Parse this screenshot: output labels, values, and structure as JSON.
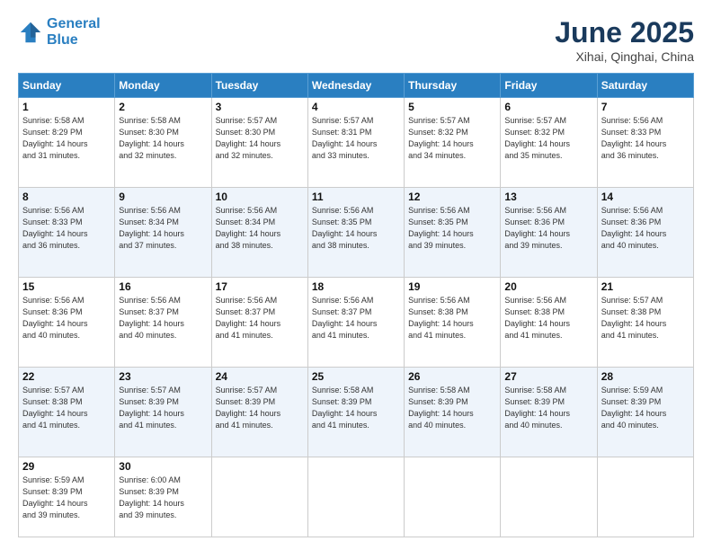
{
  "logo": {
    "line1": "General",
    "line2": "Blue"
  },
  "title": "June 2025",
  "location": "Xihai, Qinghai, China",
  "headers": [
    "Sunday",
    "Monday",
    "Tuesday",
    "Wednesday",
    "Thursday",
    "Friday",
    "Saturday"
  ],
  "rows": [
    [
      {
        "day": "1",
        "info": "Sunrise: 5:58 AM\nSunset: 8:29 PM\nDaylight: 14 hours\nand 31 minutes."
      },
      {
        "day": "2",
        "info": "Sunrise: 5:58 AM\nSunset: 8:30 PM\nDaylight: 14 hours\nand 32 minutes."
      },
      {
        "day": "3",
        "info": "Sunrise: 5:57 AM\nSunset: 8:30 PM\nDaylight: 14 hours\nand 32 minutes."
      },
      {
        "day": "4",
        "info": "Sunrise: 5:57 AM\nSunset: 8:31 PM\nDaylight: 14 hours\nand 33 minutes."
      },
      {
        "day": "5",
        "info": "Sunrise: 5:57 AM\nSunset: 8:32 PM\nDaylight: 14 hours\nand 34 minutes."
      },
      {
        "day": "6",
        "info": "Sunrise: 5:57 AM\nSunset: 8:32 PM\nDaylight: 14 hours\nand 35 minutes."
      },
      {
        "day": "7",
        "info": "Sunrise: 5:56 AM\nSunset: 8:33 PM\nDaylight: 14 hours\nand 36 minutes."
      }
    ],
    [
      {
        "day": "8",
        "info": "Sunrise: 5:56 AM\nSunset: 8:33 PM\nDaylight: 14 hours\nand 36 minutes."
      },
      {
        "day": "9",
        "info": "Sunrise: 5:56 AM\nSunset: 8:34 PM\nDaylight: 14 hours\nand 37 minutes."
      },
      {
        "day": "10",
        "info": "Sunrise: 5:56 AM\nSunset: 8:34 PM\nDaylight: 14 hours\nand 38 minutes."
      },
      {
        "day": "11",
        "info": "Sunrise: 5:56 AM\nSunset: 8:35 PM\nDaylight: 14 hours\nand 38 minutes."
      },
      {
        "day": "12",
        "info": "Sunrise: 5:56 AM\nSunset: 8:35 PM\nDaylight: 14 hours\nand 39 minutes."
      },
      {
        "day": "13",
        "info": "Sunrise: 5:56 AM\nSunset: 8:36 PM\nDaylight: 14 hours\nand 39 minutes."
      },
      {
        "day": "14",
        "info": "Sunrise: 5:56 AM\nSunset: 8:36 PM\nDaylight: 14 hours\nand 40 minutes."
      }
    ],
    [
      {
        "day": "15",
        "info": "Sunrise: 5:56 AM\nSunset: 8:36 PM\nDaylight: 14 hours\nand 40 minutes."
      },
      {
        "day": "16",
        "info": "Sunrise: 5:56 AM\nSunset: 8:37 PM\nDaylight: 14 hours\nand 40 minutes."
      },
      {
        "day": "17",
        "info": "Sunrise: 5:56 AM\nSunset: 8:37 PM\nDaylight: 14 hours\nand 41 minutes."
      },
      {
        "day": "18",
        "info": "Sunrise: 5:56 AM\nSunset: 8:37 PM\nDaylight: 14 hours\nand 41 minutes."
      },
      {
        "day": "19",
        "info": "Sunrise: 5:56 AM\nSunset: 8:38 PM\nDaylight: 14 hours\nand 41 minutes."
      },
      {
        "day": "20",
        "info": "Sunrise: 5:56 AM\nSunset: 8:38 PM\nDaylight: 14 hours\nand 41 minutes."
      },
      {
        "day": "21",
        "info": "Sunrise: 5:57 AM\nSunset: 8:38 PM\nDaylight: 14 hours\nand 41 minutes."
      }
    ],
    [
      {
        "day": "22",
        "info": "Sunrise: 5:57 AM\nSunset: 8:38 PM\nDaylight: 14 hours\nand 41 minutes."
      },
      {
        "day": "23",
        "info": "Sunrise: 5:57 AM\nSunset: 8:39 PM\nDaylight: 14 hours\nand 41 minutes."
      },
      {
        "day": "24",
        "info": "Sunrise: 5:57 AM\nSunset: 8:39 PM\nDaylight: 14 hours\nand 41 minutes."
      },
      {
        "day": "25",
        "info": "Sunrise: 5:58 AM\nSunset: 8:39 PM\nDaylight: 14 hours\nand 41 minutes."
      },
      {
        "day": "26",
        "info": "Sunrise: 5:58 AM\nSunset: 8:39 PM\nDaylight: 14 hours\nand 40 minutes."
      },
      {
        "day": "27",
        "info": "Sunrise: 5:58 AM\nSunset: 8:39 PM\nDaylight: 14 hours\nand 40 minutes."
      },
      {
        "day": "28",
        "info": "Sunrise: 5:59 AM\nSunset: 8:39 PM\nDaylight: 14 hours\nand 40 minutes."
      }
    ],
    [
      {
        "day": "29",
        "info": "Sunrise: 5:59 AM\nSunset: 8:39 PM\nDaylight: 14 hours\nand 39 minutes."
      },
      {
        "day": "30",
        "info": "Sunrise: 6:00 AM\nSunset: 8:39 PM\nDaylight: 14 hours\nand 39 minutes."
      },
      {
        "day": "",
        "info": ""
      },
      {
        "day": "",
        "info": ""
      },
      {
        "day": "",
        "info": ""
      },
      {
        "day": "",
        "info": ""
      },
      {
        "day": "",
        "info": ""
      }
    ]
  ]
}
